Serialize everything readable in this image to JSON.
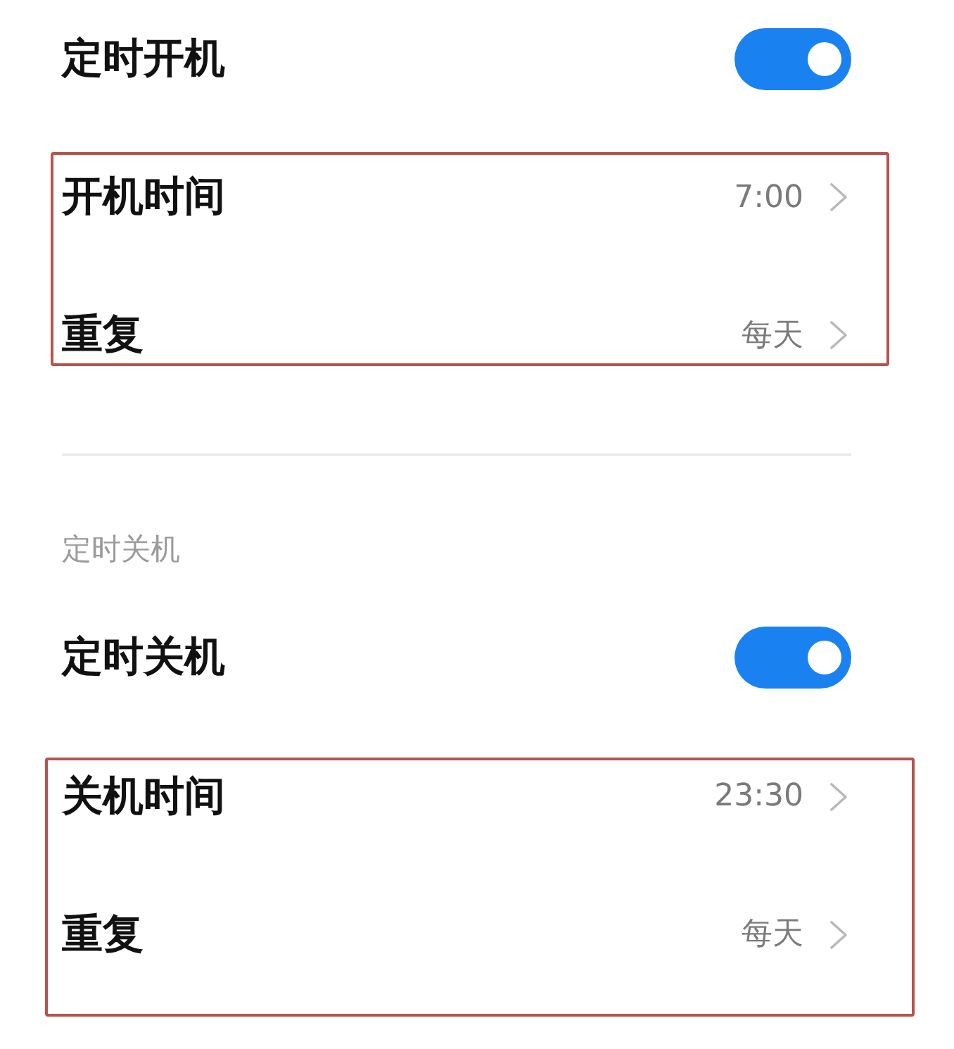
{
  "groups": [
    {
      "toggle": {
        "label": "定时开机",
        "on": true
      },
      "highlighted": true,
      "rows": [
        {
          "label": "开机时间",
          "value": "7:00"
        },
        {
          "label": "重复",
          "value": "每天"
        }
      ]
    },
    {
      "header": "定时关机",
      "toggle": {
        "label": "定时关机",
        "on": true
      },
      "highlighted": true,
      "rows": [
        {
          "label": "关机时间",
          "value": "23:30"
        },
        {
          "label": "重复",
          "value": "每天"
        }
      ]
    }
  ]
}
